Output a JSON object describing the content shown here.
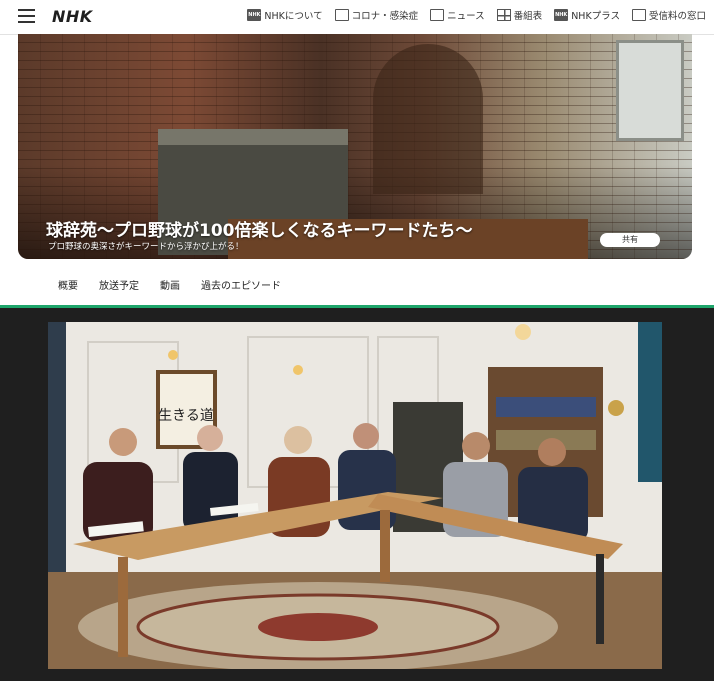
{
  "header": {
    "logo": "NHK",
    "nav": [
      {
        "icon": "nhk-badge-icon",
        "badge": "NHK",
        "label": "NHKについて"
      },
      {
        "icon": "corona-icon",
        "label": "コロナ・感染症"
      },
      {
        "icon": "news-icon",
        "label": "ニュース"
      },
      {
        "icon": "program-table-icon",
        "label": "番組表"
      },
      {
        "icon": "nhk-plus-icon",
        "badge": "NHK",
        "label": "NHKプラス"
      },
      {
        "icon": "reception-fee-icon",
        "label": "受信料の窓口"
      }
    ]
  },
  "hero": {
    "title": "球辞苑～プロ野球が100倍楽しくなるキーワードたち～",
    "subtitle": "プロ野球の奥深さがキーワードから浮かび上がる！",
    "share_label": "共有"
  },
  "tabs": [
    "概要",
    "放送予定",
    "動画",
    "過去のエピソード"
  ],
  "photo": {
    "calligraphy": "生きる道"
  },
  "colors": {
    "accent_green": "#1ea56b",
    "dark_bg": "#1f1f1f"
  }
}
